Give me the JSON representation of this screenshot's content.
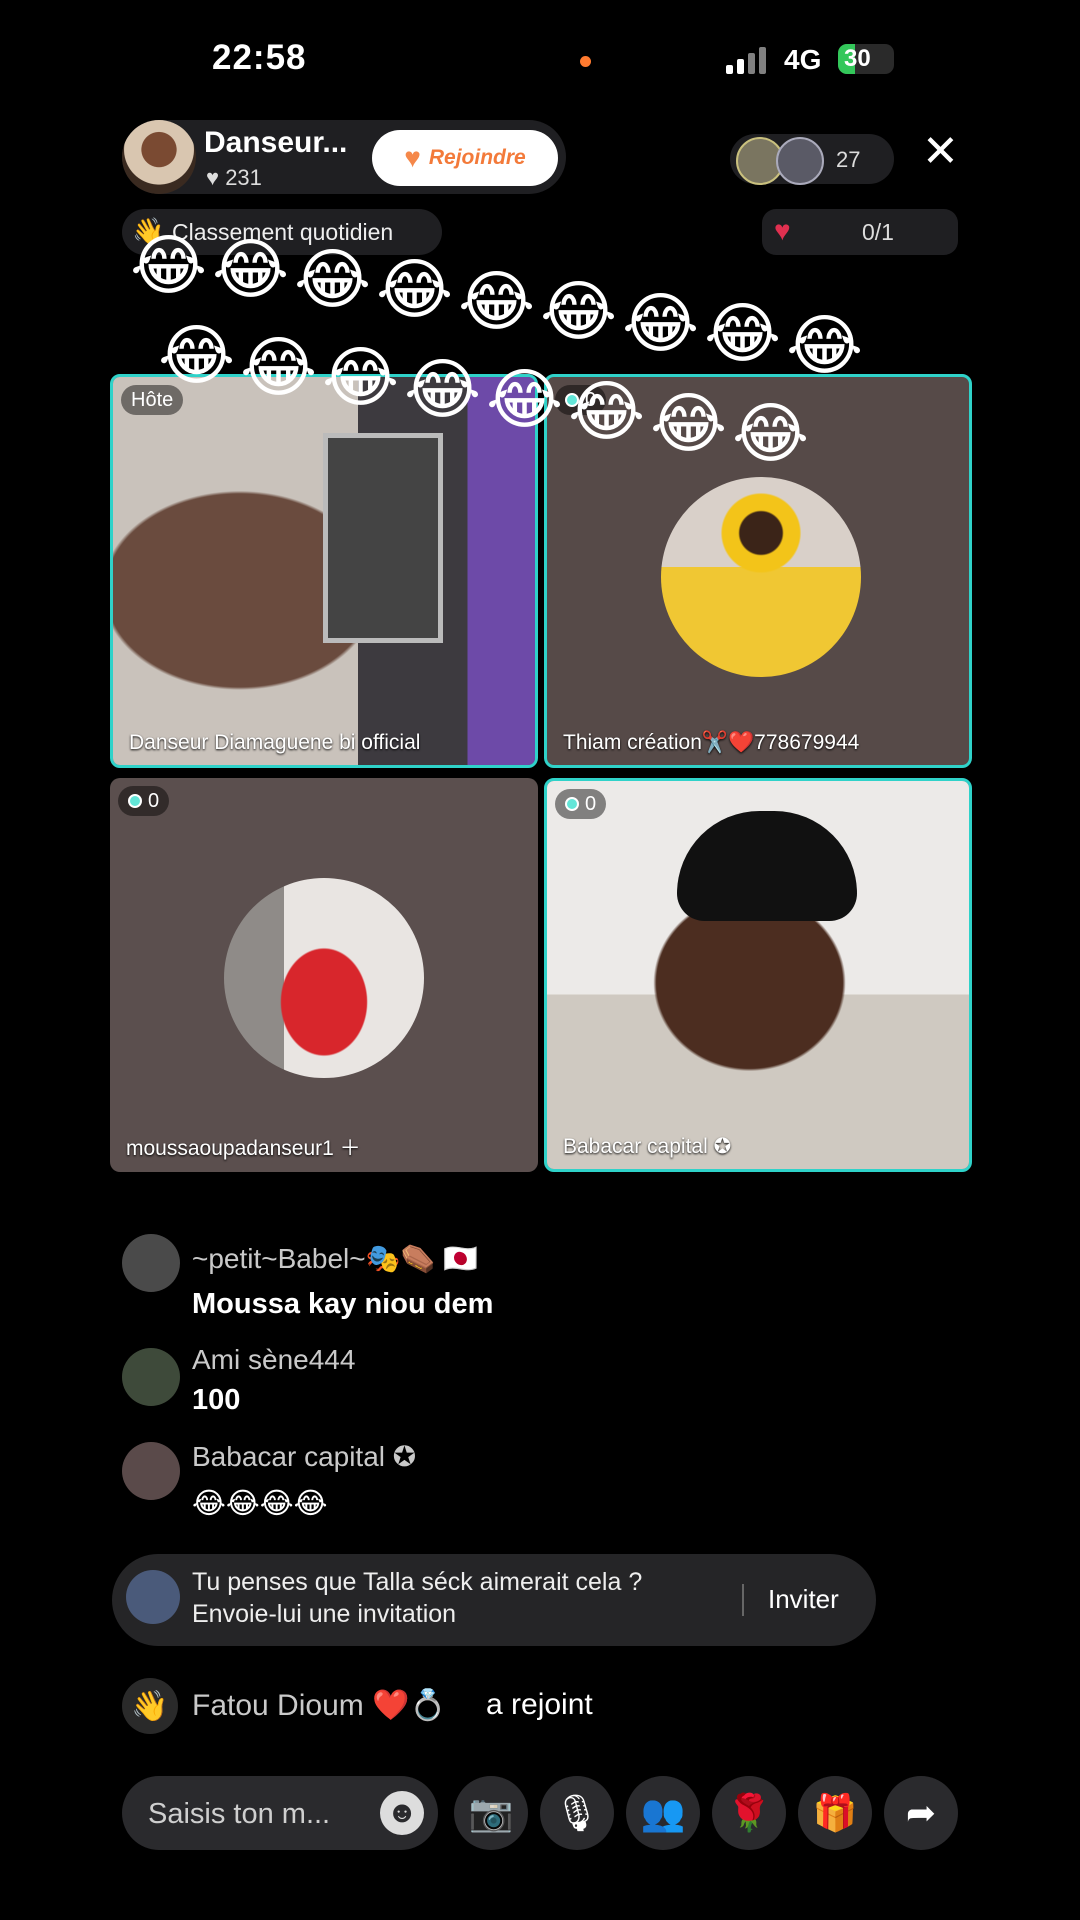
{
  "status_bar": {
    "time": "22:58",
    "network": "4G",
    "battery": "30",
    "battery_level": 0.3
  },
  "host": {
    "name": "Danseur...",
    "likes": "231",
    "join_label": "Rejoindre"
  },
  "viewers": {
    "count": "27"
  },
  "ranking": {
    "label": "Classement quotidien"
  },
  "likes_goal": {
    "value": "0/1"
  },
  "tiles": [
    {
      "label": "Danseur Diamaguene bi official",
      "badge": "Hôte"
    },
    {
      "label": "Thiam création✂️❤️778679944",
      "badge": "0"
    },
    {
      "label": "moussaoupadanseur1 ＋",
      "badge": "0"
    },
    {
      "label": "Babacar capital ✪",
      "badge": "0"
    }
  ],
  "emoji": "😂",
  "chat": [
    {
      "name": "~petit~Babel~🎭⚰️ 🇯🇵",
      "message": "Moussa kay niou dem"
    },
    {
      "name": "Ami sène444",
      "message": "100"
    },
    {
      "name": "Babacar capital ✪",
      "message": "😂😂😂😂"
    }
  ],
  "invite": {
    "line1": "Tu penses que Talla séck aimerait cela ?",
    "line2": "Envoie-lui une invitation",
    "button": "Inviter"
  },
  "joined": {
    "name": "Fatou Dioum ❤️💍",
    "action": "a rejoint"
  },
  "composer": {
    "placeholder": "Saisis ton m..."
  },
  "icons": {
    "emoji_button": "☻",
    "camera_off": "📷",
    "mic": "🎙",
    "guests": "👥",
    "rose": "🌹",
    "gift": "🎁",
    "share": "➦",
    "close": "✕",
    "wave": "👋",
    "heart": "♥"
  },
  "colors": {
    "accent": "#2fd2c9",
    "join_text": "#f37a3a",
    "battery": "#33c75a"
  }
}
